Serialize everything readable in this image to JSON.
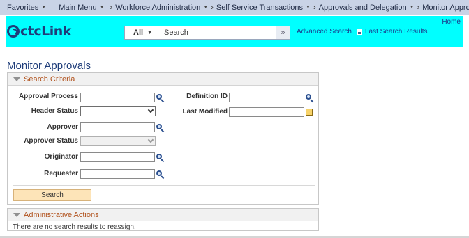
{
  "nav": {
    "favorites": "Favorites",
    "main_menu": "Main Menu",
    "breadcrumbs": [
      "Workforce Administration",
      "Self Service Transactions",
      "Approvals and Delegation",
      "Monitor Approvals"
    ]
  },
  "header": {
    "logo_text_bold": "ctc",
    "logo_text_light": "Link",
    "home_link": "Home",
    "search_scope": "All",
    "search_placeholder": "Search",
    "advanced_search": "Advanced Search",
    "last_search_results": "Last Search Results",
    "brand_color": "#00ffff"
  },
  "page": {
    "title": "Monitor Approvals"
  },
  "search_criteria": {
    "section_title": "Search Criteria",
    "fields": {
      "approval_process": {
        "label": "Approval Process",
        "value": ""
      },
      "header_status": {
        "label": "Header Status",
        "value": ""
      },
      "approver": {
        "label": "Approver",
        "value": ""
      },
      "approver_status": {
        "label": "Approver Status",
        "value": ""
      },
      "originator": {
        "label": "Originator",
        "value": ""
      },
      "requester": {
        "label": "Requester",
        "value": ""
      },
      "definition_id": {
        "label": "Definition ID",
        "value": ""
      },
      "last_modified": {
        "label": "Last Modified",
        "value": ""
      }
    },
    "search_button": "Search"
  },
  "admin_actions": {
    "section_title": "Administrative Actions",
    "message": "There are no search results to reassign."
  }
}
